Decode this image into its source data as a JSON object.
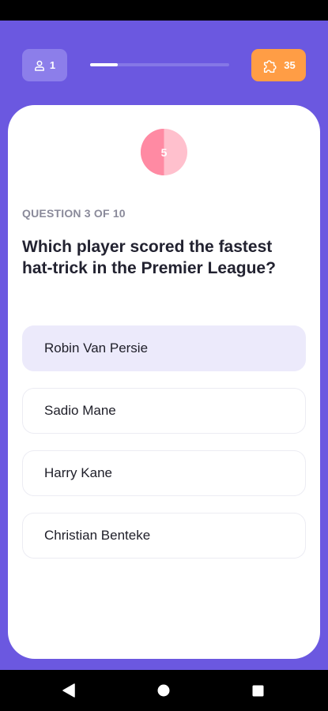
{
  "header": {
    "players_count": "1",
    "points": "35",
    "progress_fraction": 0.2
  },
  "timer": {
    "value": "5",
    "remaining_fraction": 0.5,
    "colors": {
      "remaining": "#ffc0cd",
      "elapsed": "#ff8aa3"
    }
  },
  "question": {
    "counter": "QUESTION 3 OF 10",
    "text": "Which player scored the fastest hat-trick in the Premier League?"
  },
  "options": [
    {
      "label": "Robin Van Persie",
      "selected": true
    },
    {
      "label": "Sadio Mane",
      "selected": false
    },
    {
      "label": "Harry Kane",
      "selected": false
    },
    {
      "label": "Christian Benteke",
      "selected": false
    }
  ],
  "colors": {
    "background": "#6b58e0",
    "accent_orange": "#ff9d45",
    "selected_option": "#eceafb"
  },
  "icons": {
    "players": "user-icon",
    "points": "puzzle-icon",
    "nav_back": "back-triangle-icon",
    "nav_home": "home-circle-icon",
    "nav_recents": "recents-square-icon"
  }
}
